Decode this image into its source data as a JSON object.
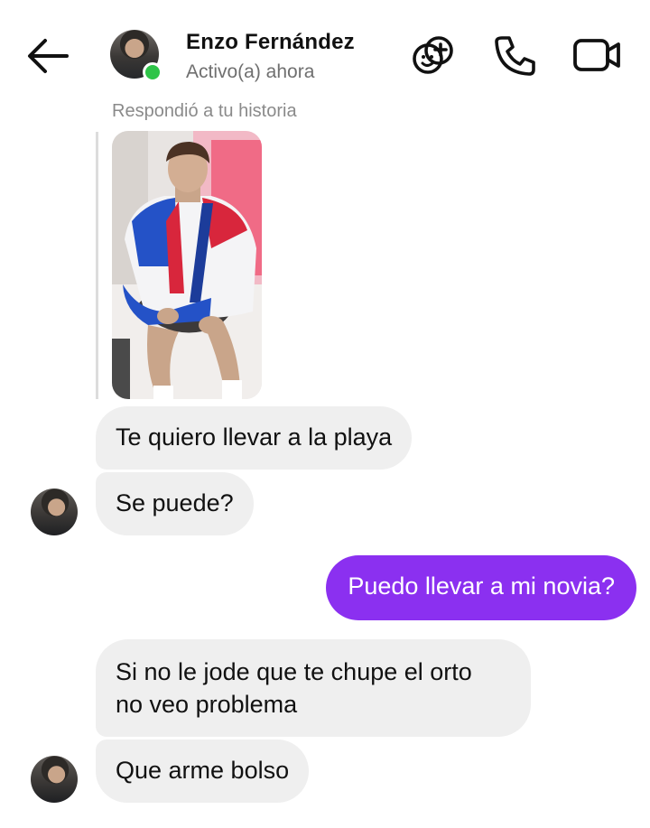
{
  "header": {
    "contact_name": "Enzo Fernández",
    "status": "Activo(a) ahora",
    "online": true,
    "icons": [
      "back-arrow-icon",
      "effects-icon",
      "phone-icon",
      "video-icon"
    ]
  },
  "story": {
    "caption": "Respondió a tu historia"
  },
  "messages": [
    {
      "direction": "incoming",
      "text": "Te quiero llevar a la playa"
    },
    {
      "direction": "incoming",
      "text": "Se puede?"
    },
    {
      "direction": "outgoing",
      "text": "Puedo llevar a mi novia?"
    },
    {
      "direction": "incoming",
      "lines": [
        "Si no le jode que te chupe el orto",
        "no veo problema"
      ]
    },
    {
      "direction": "incoming",
      "text": "Que arme bolso"
    }
  ],
  "colors": {
    "outgoing_bubble": "#8b30f0",
    "incoming_bubble": "#efefef",
    "online_dot": "#2ec448"
  }
}
